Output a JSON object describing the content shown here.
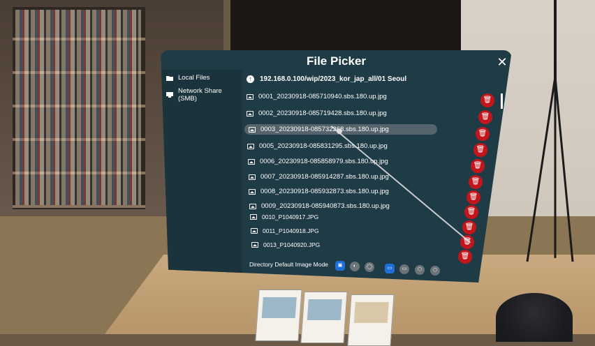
{
  "window": {
    "title": "File Picker",
    "close_glyph": "✕"
  },
  "sidebar": {
    "items": [
      {
        "label": "Local Files",
        "icon": "folder-icon"
      },
      {
        "label": "Network Share (SMB)",
        "icon": "network-drive-icon"
      }
    ]
  },
  "path": {
    "current": "192.168.0.100/wip/2023_kor_jap_all/01 Seoul",
    "icon": "up-arrow-icon"
  },
  "files": [
    {
      "name": "0001_20230918-085710940.sbs.180.up.jpg"
    },
    {
      "name": "0002_20230918-085719428.sbs.180.up.jpg"
    },
    {
      "name": "0003_20230918-085732268.sbs.180.up.jpg",
      "selected": true
    },
    {
      "name": "0005_20230918-085831295.sbs.180.up.jpg"
    },
    {
      "name": "0006_20230918-085858979.sbs.180.up.jpg"
    },
    {
      "name": "0007_20230918-085914287.sbs.180.up.jpg"
    },
    {
      "name": "0008_20230918-085932873.sbs.180.up.jpg"
    },
    {
      "name": "0009_20230918-085940873.sbs.180.up.jpg"
    },
    {
      "name": "0010_P1040917.JPG"
    },
    {
      "name": "0011_P1040918.JPG"
    },
    {
      "name": "0013_P1040920.JPG"
    }
  ],
  "footer": {
    "mode_label": "Directory Default Image Mode"
  },
  "colors": {
    "panel_bg": "#1f3b45",
    "delete_red": "#c3161c",
    "active_mode": "#1e6fd9"
  }
}
